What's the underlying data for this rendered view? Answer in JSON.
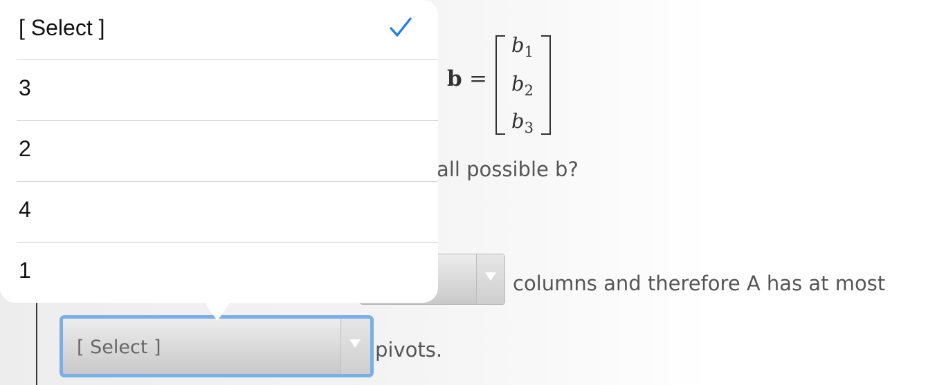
{
  "math": {
    "lhs": "b",
    "equals": "=",
    "entries": [
      {
        "base": "b",
        "sub": "1"
      },
      {
        "base": "b",
        "sub": "2"
      },
      {
        "base": "b",
        "sub": "3"
      }
    ]
  },
  "question": {
    "fragment": "all possible b?"
  },
  "sentence": {
    "columns_text": "columns and therefore A has at most",
    "pivots_text": "pivots."
  },
  "select_focused": {
    "value": "[ Select ]"
  },
  "dropdown": {
    "options": [
      {
        "label": "[ Select ]",
        "selected": true
      },
      {
        "label": "3",
        "selected": false
      },
      {
        "label": "2",
        "selected": false
      },
      {
        "label": "4",
        "selected": false
      },
      {
        "label": "1",
        "selected": false
      }
    ],
    "check_icon": "checkmark-icon"
  },
  "colors": {
    "accent": "#1a7cf0",
    "focus_ring": "#7aaee8"
  }
}
